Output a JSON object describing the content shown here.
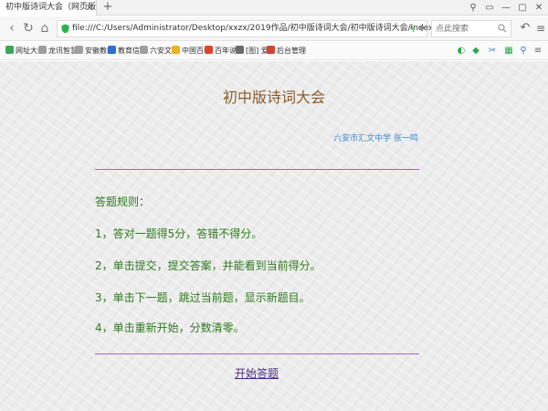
{
  "tab": {
    "title": "初中版诗词大会（网页版）",
    "close": "×",
    "new": "+"
  },
  "window_controls": [
    "⚲",
    "▭",
    "—",
    "▢",
    "✕"
  ],
  "nav": {
    "back": "‹",
    "reload": "↻",
    "home": "⌂"
  },
  "address": {
    "url": "file:///C:/Users/Administrator/Desktop/xxzx/2019作品/初中版诗词大会/初中版诗词大会/index.html"
  },
  "search": {
    "placeholder": "点此搜索"
  },
  "toolbar": {
    "undo": "↶",
    "menu": "≡"
  },
  "bookmarks": [
    {
      "label": "网址大全",
      "color": "#3aa757"
    },
    {
      "label": "龙讯智慧",
      "color": "#9e9e9e"
    },
    {
      "label": "安徽教教",
      "color": "#9e9e9e"
    },
    {
      "label": "教育信息",
      "color": "#2e6fd6"
    },
    {
      "label": "六安文明",
      "color": "#9e9e9e"
    },
    {
      "label": "中国百每",
      "color": "#f2b01e"
    },
    {
      "label": "百年说",
      "color": "#e0452c"
    },
    {
      "label": "[图] 爱",
      "color": "#6b6b6b"
    },
    {
      "label": "后台管理",
      "color": "#d64532"
    }
  ],
  "bookmark_tools": [
    {
      "glyph": "◐",
      "color": "#2ba84a"
    },
    {
      "glyph": "◆",
      "color": "#2ba84a"
    },
    {
      "glyph": "✂",
      "color": "#3a7bd5"
    },
    {
      "glyph": "▦",
      "color": "#2ba84a"
    },
    {
      "glyph": "⚲",
      "color": "#3a7bd5"
    },
    {
      "glyph": "≡",
      "color": "#666666"
    }
  ],
  "page": {
    "title": "初中版诗词大会",
    "author": "六安市汇文中学 张一鸣",
    "rules_heading": "答题规则：",
    "rules": [
      "1，答对一题得5分，答错不得分。",
      "2，单击提交，提交答案，并能看到当前得分。",
      "3，单击下一题，跳过当前题，显示新题目。",
      "4，单击重新开始，分数清零。"
    ],
    "start": "开始答题"
  }
}
